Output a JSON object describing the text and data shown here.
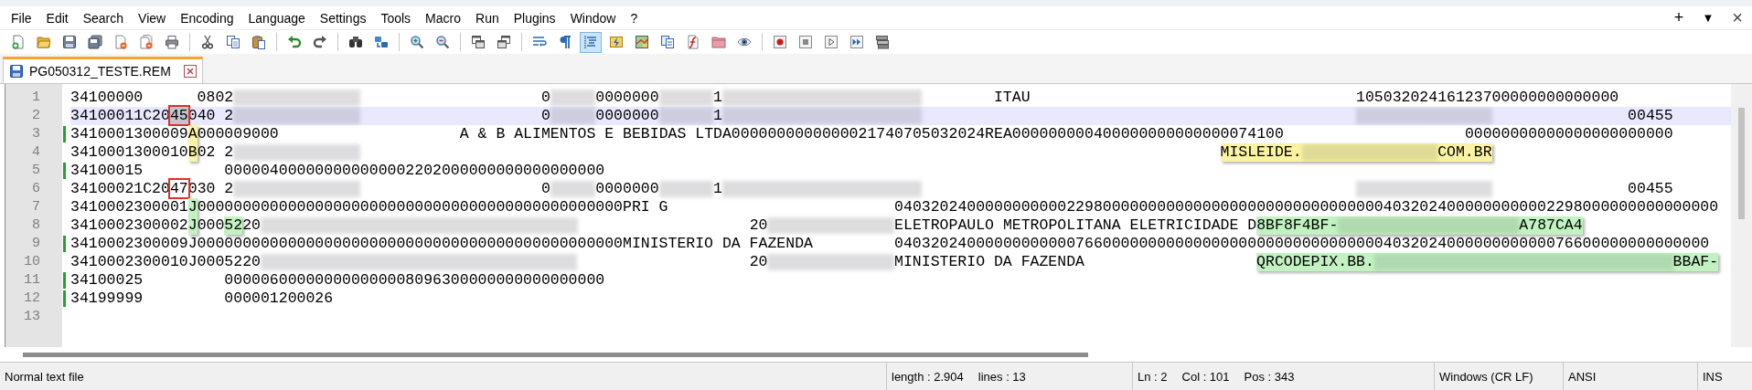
{
  "menu": [
    "File",
    "Edit",
    "Search",
    "View",
    "Encoding",
    "Language",
    "Settings",
    "Tools",
    "Macro",
    "Run",
    "Plugins",
    "Window",
    "?"
  ],
  "window_controls": [
    {
      "kind": "add",
      "label": "+"
    },
    {
      "kind": "dropdown",
      "label": "▼"
    },
    {
      "kind": "close",
      "label": "×"
    }
  ],
  "toolbar": [
    [
      {
        "kind": "new",
        "pressed": false
      },
      {
        "kind": "open",
        "pressed": false
      },
      {
        "kind": "save",
        "pressed": false
      },
      {
        "kind": "save-all",
        "pressed": false
      },
      {
        "kind": "close",
        "pressed": false
      },
      {
        "kind": "close-all",
        "pressed": false
      },
      {
        "kind": "print",
        "pressed": false
      }
    ],
    [
      {
        "kind": "cut",
        "pressed": false
      },
      {
        "kind": "copy",
        "pressed": false
      },
      {
        "kind": "paste",
        "pressed": false
      }
    ],
    [
      {
        "kind": "undo",
        "pressed": false
      },
      {
        "kind": "redo",
        "pressed": false
      }
    ],
    [
      {
        "kind": "find",
        "pressed": false
      },
      {
        "kind": "replace",
        "pressed": false
      }
    ],
    [
      {
        "kind": "zoom-in",
        "pressed": false
      },
      {
        "kind": "zoom-out",
        "pressed": false
      }
    ],
    [
      {
        "kind": "sync-v",
        "pressed": false
      },
      {
        "kind": "sync-h",
        "pressed": false
      }
    ],
    [
      {
        "kind": "wrap",
        "pressed": false
      },
      {
        "kind": "all-chars",
        "pressed": false
      },
      {
        "kind": "indent-guide",
        "pressed": true
      },
      {
        "kind": "language",
        "pressed": false
      },
      {
        "kind": "doc-map",
        "pressed": false
      },
      {
        "kind": "doc-list",
        "pressed": false
      },
      {
        "kind": "function-list",
        "pressed": false
      },
      {
        "kind": "folder",
        "pressed": false
      },
      {
        "kind": "monitor",
        "pressed": false
      }
    ],
    [
      {
        "kind": "record",
        "pressed": false
      },
      {
        "kind": "stop",
        "pressed": false
      },
      {
        "kind": "play",
        "pressed": false
      },
      {
        "kind": "play-repeat",
        "pressed": false
      },
      {
        "kind": "save-macro",
        "pressed": false
      }
    ]
  ],
  "tabs": [
    {
      "label": "PG050312_TESTE.REM",
      "selected": true
    }
  ],
  "editor": {
    "lines": [
      {
        "number": "1",
        "changed": false,
        "current": false,
        "segments": [
          {
            "text": "34100000      0802"
          },
          {
            "kind": "redacted"
          },
          {
            "text": "                    0"
          },
          {
            "kind": "redacted"
          },
          {
            "text": "0000000"
          },
          {
            "kind": "redacted"
          },
          {
            "text": "1"
          },
          {
            "kind": "redacted"
          },
          {
            "text": "        ITAU"
          },
          {
            "text": "                                    10503202416123700000000000000"
          }
        ]
      },
      {
        "number": "2",
        "changed": false,
        "current": true,
        "segments": [
          {
            "text": "34100011C20"
          },
          {
            "text": "45",
            "boxed": true,
            "selected": true
          },
          {
            "text": "040 2"
          },
          {
            "kind": "redacted"
          },
          {
            "text": "                    0"
          },
          {
            "kind": "redacted"
          },
          {
            "text": "0000000"
          },
          {
            "kind": "redacted"
          },
          {
            "text": "1"
          },
          {
            "kind": "redacted"
          },
          {
            "kind": "redacted"
          },
          {
            "text": "               00455"
          }
        ]
      },
      {
        "number": "3",
        "changed": true,
        "current": false,
        "segments": [
          {
            "text": "3410001300009"
          },
          {
            "kind": "highlight",
            "color": "#fbf3a4",
            "parts": [
              {
                "text": "A"
              }
            ]
          },
          {
            "text": "000009000"
          },
          {
            "text": "                    A & B ALIMENTOS E BEBIDAS LTDA0000000000000021740705032024REA000000000400000000000000074100"
          },
          {
            "text": "                    00000000000000000000000"
          }
        ]
      },
      {
        "number": "4",
        "changed": false,
        "current": false,
        "segments": [
          {
            "text": "3410001300010"
          },
          {
            "kind": "highlight",
            "color": "#fbf3a4",
            "parts": [
              {
                "text": "B"
              }
            ]
          },
          {
            "text": "02 2"
          },
          {
            "kind": "redacted"
          },
          {
            "kind": "highlight",
            "color": "#fbf3a4",
            "parts": [
              {
                "text": "MISLEIDE."
              },
              {
                "kind": "redacted"
              },
              {
                "text": "COM.BR"
              }
            ]
          }
        ]
      },
      {
        "number": "5",
        "changed": true,
        "current": false,
        "segments": [
          {
            "text": "34100015         000004000000000000002202000000000000000000"
          }
        ]
      },
      {
        "number": "6",
        "changed": false,
        "current": false,
        "segments": [
          {
            "text": "34100021C20"
          },
          {
            "text": "47",
            "boxed": true,
            "selected": false
          },
          {
            "text": "030 2"
          },
          {
            "kind": "redacted"
          },
          {
            "text": "                    0"
          },
          {
            "kind": "redacted"
          },
          {
            "text": "0000000"
          },
          {
            "kind": "redacted"
          },
          {
            "text": "1"
          },
          {
            "kind": "redacted"
          },
          {
            "kind": "redacted"
          },
          {
            "text": "               00455"
          }
        ]
      },
      {
        "number": "7",
        "changed": false,
        "current": false,
        "segments": [
          {
            "text": "3410002300001"
          },
          {
            "kind": "highlight",
            "color": "#c2f2c2",
            "parts": [
              {
                "text": "J"
              }
            ]
          },
          {
            "text": "00000000000000000000000000000000000000000000000PRI G"
          },
          {
            "text": "                         0403202400000000000229800000000000000000000000000000004032024000000000002298000000000000000"
          }
        ]
      },
      {
        "number": "8",
        "changed": false,
        "current": false,
        "segments": [
          {
            "text": "3410002300002"
          },
          {
            "kind": "highlight",
            "color": "#c2f2c2",
            "parts": [
              {
                "text": "J"
              }
            ]
          },
          {
            "text": "000"
          },
          {
            "kind": "highlight",
            "color": "#c2f2c2",
            "parts": [
              {
                "text": "52"
              }
            ]
          },
          {
            "text": "20"
          },
          {
            "kind": "redacted"
          },
          {
            "text": "                   20"
          },
          {
            "kind": "redacted"
          },
          {
            "text": "ELETROPAULO METROPOLITANA ELETRICIDADE D"
          },
          {
            "kind": "highlight",
            "color": "#c2f2c2",
            "parts": [
              {
                "text": "8BF8F4BF-"
              },
              {
                "kind": "redacted"
              },
              {
                "text": "A787CA4"
              }
            ]
          }
        ]
      },
      {
        "number": "9",
        "changed": true,
        "current": false,
        "segments": [
          {
            "text": "3410002300009J00000000000000000000000000000000000000000000000MINISTERIO DA FAZENDA"
          },
          {
            "text": "         040320240000000000007660000000000000000000000000000000403202400000000000076600000000000000"
          }
        ]
      },
      {
        "number": "10",
        "changed": false,
        "current": false,
        "segments": [
          {
            "text": "3410002300010J0005220"
          },
          {
            "kind": "redacted"
          },
          {
            "text": "                   20"
          },
          {
            "kind": "redacted"
          },
          {
            "text": "MINISTERIO DA FAZENDA"
          },
          {
            "kind": "highlight",
            "color": "#c2f2c2",
            "parts": [
              {
                "text": "QRCODEPIX.BB."
              },
              {
                "kind": "redacted"
              },
              {
                "text": "BBAF-"
              }
            ]
          }
        ]
      },
      {
        "number": "11",
        "changed": true,
        "current": false,
        "segments": [
          {
            "text": "34100025         000006000000000000008096300000000000000000"
          }
        ]
      },
      {
        "number": "12",
        "changed": true,
        "current": false,
        "segments": [
          {
            "text": "34199999         000001200026"
          }
        ]
      },
      {
        "number": "13",
        "changed": false,
        "current": false
      }
    ]
  },
  "status_bar": [
    {
      "texts": [
        "Normal text file"
      ]
    },
    {
      "texts": [
        "length : 2.904",
        "lines : 13"
      ]
    },
    {
      "texts": [
        "Ln : 2",
        "Col : 101",
        "Pos : 343"
      ]
    },
    {
      "texts": [
        "Windows (CR LF)"
      ]
    },
    {
      "texts": [
        "ANSI"
      ]
    },
    {
      "texts": [
        "INS"
      ]
    }
  ]
}
